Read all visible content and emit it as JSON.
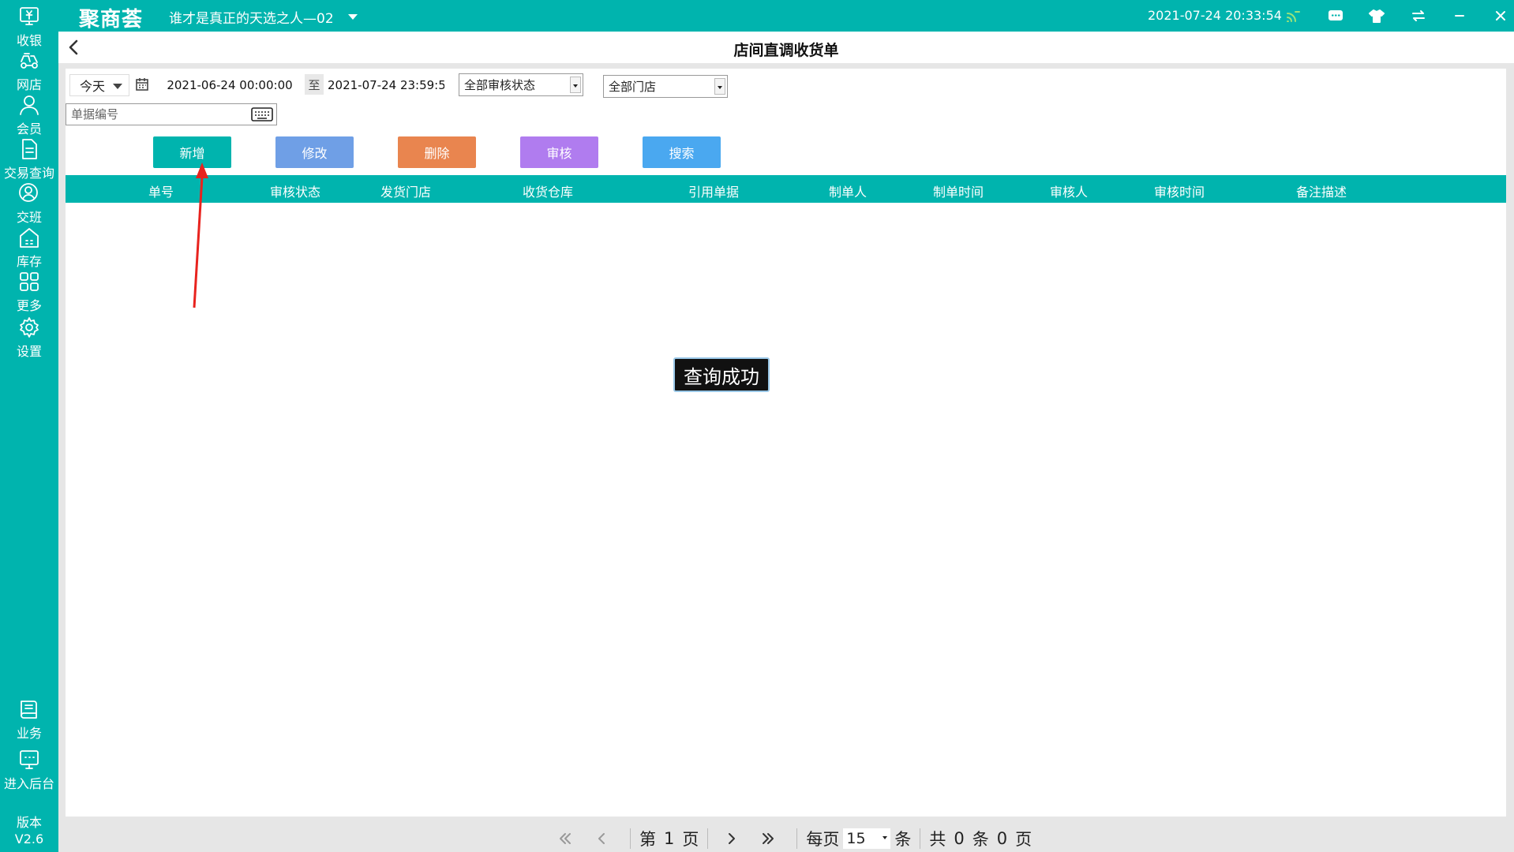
{
  "sidebar": {
    "items": [
      {
        "label": "收银",
        "icon": "cashier-icon"
      },
      {
        "label": "网店",
        "icon": "delivery-icon"
      },
      {
        "label": "会员",
        "icon": "member-icon"
      },
      {
        "label": "交易查询",
        "icon": "document-icon"
      },
      {
        "label": "交班",
        "icon": "shift-icon"
      },
      {
        "label": "库存",
        "icon": "warehouse-icon"
      },
      {
        "label": "更多",
        "icon": "grid-icon"
      },
      {
        "label": "设置",
        "icon": "gear-icon"
      },
      {
        "label": "业务",
        "icon": "book-icon"
      },
      {
        "label": "进入后台",
        "icon": "monitor-icon"
      }
    ],
    "version_label": "版本",
    "version_value": "V2.6"
  },
  "titlebar": {
    "logo": "聚商荟",
    "store_name": "谁才是真正的天选之人—02",
    "datetime": "2021-07-24 20:33:54"
  },
  "page": {
    "title": "店间直调收货单"
  },
  "filters": {
    "date_preset": "今天",
    "start_date": "2021-06-24 00:00:00",
    "to_label": "至",
    "end_date": "2021-07-24 23:59:59",
    "audit_status": "全部审核状态",
    "store": "全部门店",
    "doc_no_placeholder": "单据编号"
  },
  "actions": {
    "add": "新增",
    "edit": "修改",
    "delete": "删除",
    "audit": "审核",
    "search": "搜索"
  },
  "colors": {
    "brand": "#00b4ae",
    "add": "#00b4ae",
    "edit": "#6f9fe6",
    "delete": "#e9854f",
    "audit": "#b07cef",
    "search": "#4aa8f0",
    "annotation_arrow": "#e8231e"
  },
  "table": {
    "columns": [
      "单号",
      "审核状态",
      "发货门店",
      "收货仓库",
      "引用单据",
      "制单人",
      "制单时间",
      "审核人",
      "审核时间",
      "备注描述"
    ],
    "rows": []
  },
  "toast": "查询成功",
  "pagination": {
    "page_prefix": "第",
    "current_page": "1",
    "page_suffix": "页",
    "per_page_label": "每页",
    "per_page_value": "15",
    "per_page_unit": "条",
    "total_prefix": "共",
    "total_records": "0",
    "total_records_unit": "条",
    "total_pages": "0",
    "total_pages_unit": "页"
  }
}
